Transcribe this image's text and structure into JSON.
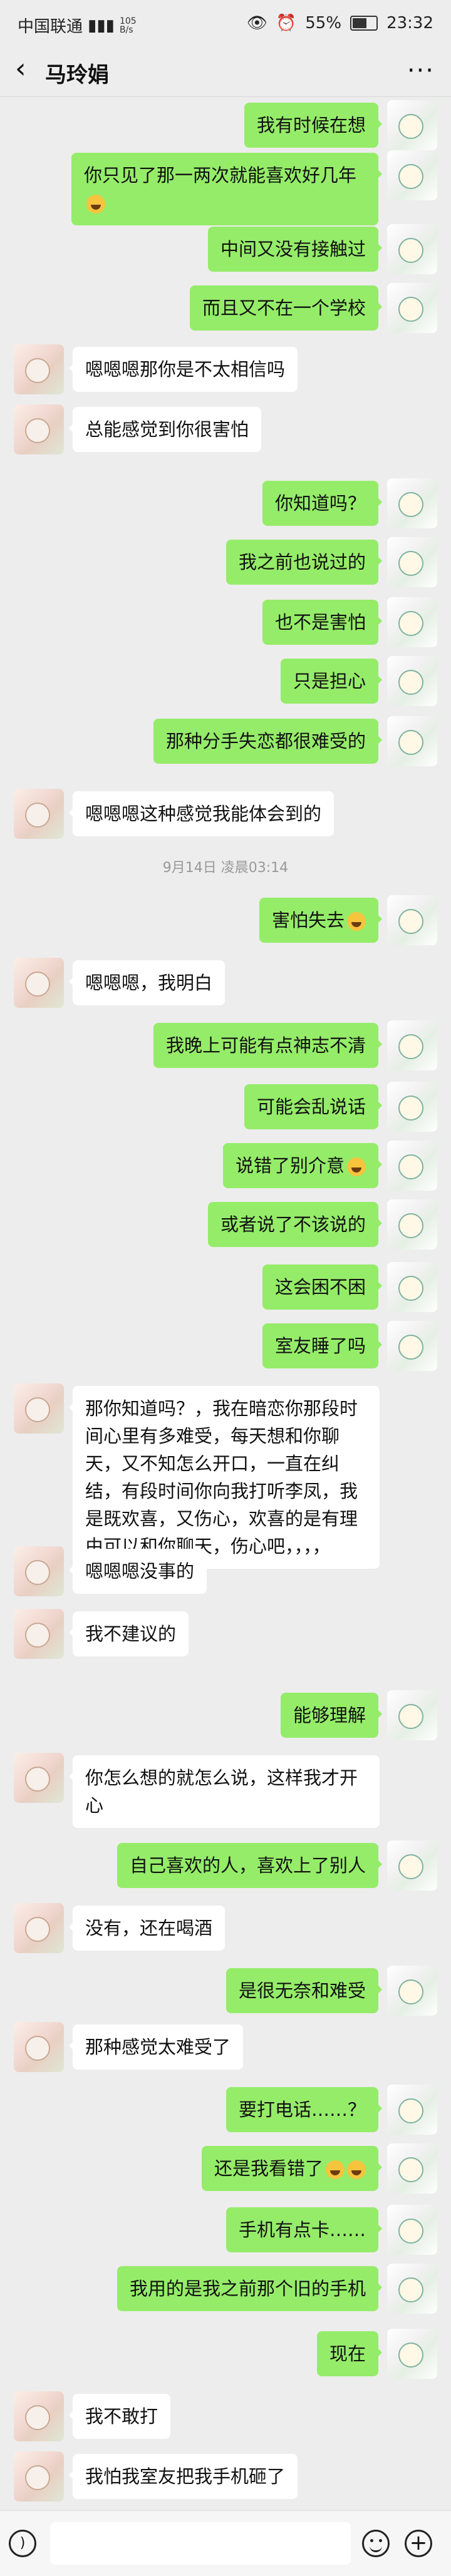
{
  "status_bar": {
    "carrier": "中国联通",
    "network_speed": "105\nB/s",
    "battery": "55%",
    "time": "23:32"
  },
  "navbar": {
    "title": "马玲娟"
  },
  "messages": [
    {
      "side": "right",
      "text": "我有时候在想"
    },
    {
      "side": "right",
      "text": "你只见了那一两次就能喜欢好几年",
      "emoji": true
    },
    {
      "side": "right",
      "text": "中间又没有接触过"
    },
    {
      "side": "right",
      "text": "而且又不在一个学校"
    },
    {
      "side": "left",
      "text": "嗯嗯嗯那你是不太相信吗"
    },
    {
      "side": "left",
      "text": "总能感觉到你很害怕"
    },
    {
      "side": "right",
      "text": "你知道吗？"
    },
    {
      "side": "right",
      "text": "我之前也说过的"
    },
    {
      "side": "right",
      "text": "也不是害怕"
    },
    {
      "side": "right",
      "text": "只是担心"
    },
    {
      "side": "right",
      "text": "那种分手失恋都很难受的"
    },
    {
      "side": "left",
      "text": "嗯嗯嗯这种感觉我能体会到的"
    },
    {
      "side": "right",
      "text": "害怕失去",
      "emoji": true
    },
    {
      "side": "left",
      "text": "嗯嗯嗯，我明白"
    },
    {
      "side": "right",
      "text": "我晚上可能有点神志不清"
    },
    {
      "side": "right",
      "text": "可能会乱说话"
    },
    {
      "side": "right",
      "text": "说错了别介意",
      "emoji": true
    },
    {
      "side": "right",
      "text": "或者说了不该说的"
    },
    {
      "side": "right",
      "text": "这会困不困"
    },
    {
      "side": "right",
      "text": "室友睡了吗"
    },
    {
      "side": "left",
      "text": "那你知道吗？，我在暗恋你那段时间心里有多难受，每天想和你聊天，又不知怎么开口，一直在纠结，有段时间你向我打听李凤，我是既欢喜，又伤心，欢喜的是有理由可以和你聊天，伤心吧，，，，"
    },
    {
      "side": "left",
      "text": "嗯嗯嗯没事的"
    },
    {
      "side": "left",
      "text": "我不建议的"
    },
    {
      "side": "right",
      "text": "能够理解"
    },
    {
      "side": "left",
      "text": "你怎么想的就怎么说，这样我才开心"
    },
    {
      "side": "right",
      "text": "自己喜欢的人，喜欢上了别人"
    },
    {
      "side": "left",
      "text": "没有，还在喝酒"
    },
    {
      "side": "right",
      "text": "是很无奈和难受"
    },
    {
      "side": "left",
      "text": "那种感觉太难受了"
    },
    {
      "side": "right",
      "text": "要打电话……？"
    },
    {
      "side": "right",
      "text": "还是我看错了",
      "emoji": true,
      "emoji2": true
    },
    {
      "side": "right",
      "text": "手机有点卡……"
    },
    {
      "side": "right",
      "text": "我用的是我之前那个旧的手机"
    },
    {
      "side": "right",
      "text": "现在"
    },
    {
      "side": "left",
      "text": "我不敢打"
    },
    {
      "side": "left",
      "text": "我怕我室友把我手机砸了"
    }
  ],
  "timestamp": "9月14日 凌晨03:14",
  "input_bar": {
    "voice_icon": "voice-icon",
    "emoji_icon": "emoji-icon",
    "plus_icon": "plus-icon"
  }
}
